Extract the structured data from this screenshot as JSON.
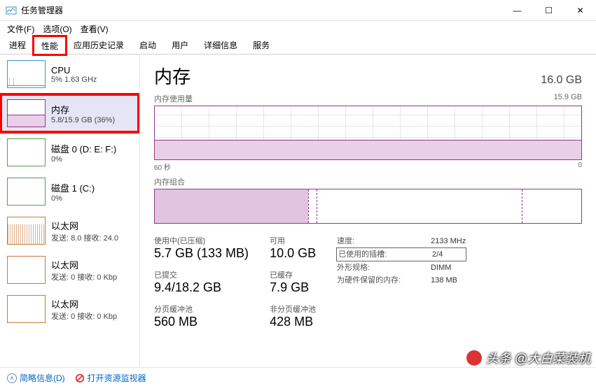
{
  "window": {
    "title": "任务管理器",
    "min": "—",
    "max": "☐",
    "close": "✕"
  },
  "menu": {
    "file": "文件(F)",
    "options": "选项(O)",
    "view": "查看(V)"
  },
  "tabs": {
    "processes": "进程",
    "performance": "性能",
    "history": "应用历史记录",
    "startup": "启动",
    "users": "用户",
    "details": "详细信息",
    "services": "服务"
  },
  "sidebar": {
    "cpu": {
      "title": "CPU",
      "sub": "5% 1.63 GHz"
    },
    "mem": {
      "title": "内存",
      "sub": "5.8/15.9 GB (36%)"
    },
    "disk0": {
      "title": "磁盘 0 (D: E: F:)",
      "sub": "0%"
    },
    "disk1": {
      "title": "磁盘 1 (C:)",
      "sub": "0%"
    },
    "eth0": {
      "title": "以太网",
      "sub": "发送: 8.0 接收: 24.0"
    },
    "eth1": {
      "title": "以太网",
      "sub": "发送: 0 接收: 0 Kbp"
    },
    "eth2": {
      "title": "以太网",
      "sub": "发送: 0 接收: 0 Kbp"
    }
  },
  "detail": {
    "title": "内存",
    "total": "16.0 GB",
    "usage_label": "内存使用量",
    "usage_max": "15.9 GB",
    "axis_left": "60 秒",
    "axis_right": "0",
    "compo_label": "内存组合",
    "stats": {
      "inuse_label": "使用中(已压缩)",
      "inuse_value": "5.7 GB (133 MB)",
      "avail_label": "可用",
      "avail_value": "10.0 GB",
      "commit_label": "已提交",
      "commit_value": "9.4/18.2 GB",
      "cached_label": "已缓存",
      "cached_value": "7.9 GB",
      "paged_label": "分页缓冲池",
      "paged_value": "560 MB",
      "nonpaged_label": "非分页缓冲池",
      "nonpaged_value": "428 MB"
    },
    "info": {
      "speed_k": "速度:",
      "speed_v": "2133 MHz",
      "slots_k": "已使用的插槽:",
      "slots_v": "2/4",
      "form_k": "外形规格:",
      "form_v": "DIMM",
      "reserved_k": "为硬件保留的内存:",
      "reserved_v": "138 MB"
    }
  },
  "status": {
    "brief": "简略信息(D)",
    "resmon": "打开资源监视器"
  },
  "watermark": "头条 @大白菜装机",
  "chart_data": {
    "type": "area",
    "title": "内存使用量",
    "x_range_seconds": [
      60,
      0
    ],
    "ylim": [
      0,
      15.9
    ],
    "ylabel": "GB",
    "series": [
      {
        "name": "used_gb",
        "values": [
          5.8,
          5.8,
          5.8,
          5.8,
          5.8,
          5.8,
          5.8,
          5.8,
          5.8,
          5.8,
          5.8,
          5.8
        ]
      }
    ],
    "composition": {
      "total_gb": 15.9,
      "in_use_gb": 5.7,
      "compressed_mb": 133,
      "cached_gb": 7.9,
      "available_gb": 10.0
    }
  }
}
